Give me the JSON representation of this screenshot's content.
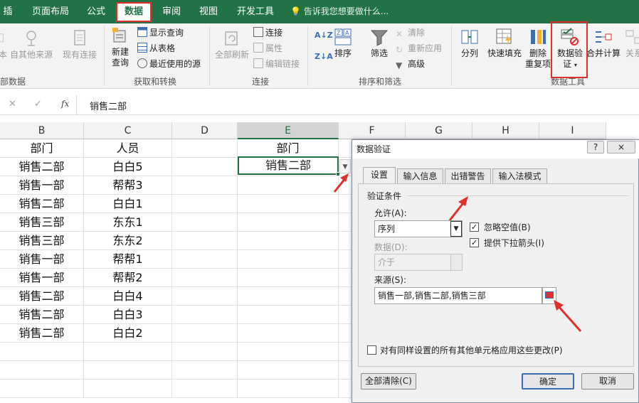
{
  "ribbon_tabs": [
    "插入",
    "页面布局",
    "公式",
    "数据",
    "审阅",
    "视图",
    "开发工具"
  ],
  "tell_me": "告诉我您想要做什么...",
  "ribbon": {
    "ext_data": {
      "from_table_partial": "本",
      "from_other": "自其他来源",
      "existing": "现有连接",
      "group_label": "部数据"
    },
    "get_transform": {
      "new_query": "新建",
      "new_query2": "查询",
      "show_query": "显示查询",
      "from_table": "从表格",
      "recent": "最近使用的源",
      "group_label": "获取和转换"
    },
    "connections": {
      "refresh_all": "全部刷新",
      "connections": "连接",
      "properties": "属性",
      "edit_links": "编辑链接",
      "group_label": "连接"
    },
    "sort_filter": {
      "sort": "排序",
      "filter": "筛选",
      "clear": "清除",
      "reapply": "重新应用",
      "advanced": "高级",
      "group_label": "排序和筛选"
    },
    "data_tools": {
      "text_to_cols": "分列",
      "flash_fill": "快速填充",
      "remove_dup": "删除",
      "remove_dup2": "重复项",
      "validation": "数据验",
      "validation2": "证",
      "consolidate": "合并计算",
      "relations": "关系",
      "group_label": "数据工具"
    }
  },
  "formula_bar": {
    "fx": "fx",
    "value": "销售二部"
  },
  "columns": [
    "B",
    "C",
    "D",
    "E",
    "F",
    "G",
    "H",
    "I"
  ],
  "sheet": {
    "header_b": "部门",
    "header_c": "人员",
    "header_e": "部门",
    "e_value": "销售二部",
    "rows": [
      [
        "销售二部",
        "白白5"
      ],
      [
        "销售一部",
        "帮帮3"
      ],
      [
        "销售二部",
        "白白1"
      ],
      [
        "销售三部",
        "东东1"
      ],
      [
        "销售三部",
        "东东2"
      ],
      [
        "销售一部",
        "帮帮1"
      ],
      [
        "销售一部",
        "帮帮2"
      ],
      [
        "销售二部",
        "白白4"
      ],
      [
        "销售二部",
        "白白3"
      ],
      [
        "销售二部",
        "白白2"
      ]
    ]
  },
  "dialog": {
    "title": "数据验证",
    "help": "?",
    "close": "×",
    "tabs": [
      "设置",
      "输入信息",
      "出错警告",
      "输入法模式"
    ],
    "section": "验证条件",
    "allow_label": "允许(A):",
    "allow_value": "序列",
    "ignore_blank": "忽略空值(B)",
    "dropdown": "提供下拉箭头(I)",
    "data_label": "数据(D):",
    "data_value": "介于",
    "source_label": "来源(S):",
    "source_value": "销售一部,销售二部,销售三部",
    "apply_all": "对有同样设置的所有其他单元格应用这些更改(P)",
    "clear_all": "全部清除(C)",
    "ok": "确定",
    "cancel": "取消"
  },
  "colors": {
    "excel_green": "#217346",
    "highlight_red": "#e0302c"
  }
}
